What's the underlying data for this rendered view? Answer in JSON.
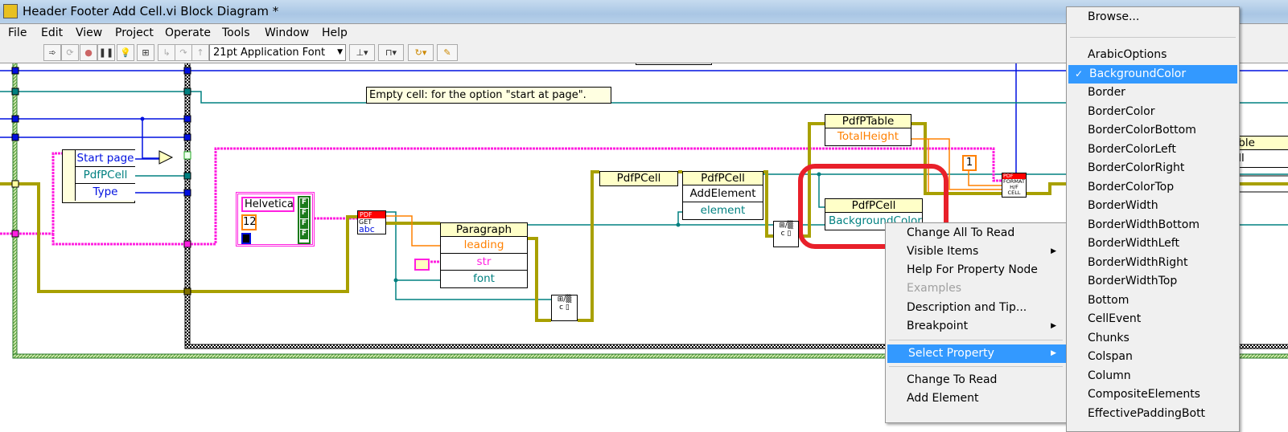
{
  "window": {
    "title": "Header Footer Add Cell.vi Block Diagram *"
  },
  "menu": [
    "File",
    "Edit",
    "View",
    "Project",
    "Operate",
    "Tools",
    "Window",
    "Help"
  ],
  "toolbar": {
    "font": "21pt Application Font",
    "buttons": [
      "run-arrow-icon",
      "run-continuous-icon",
      "abort-icon",
      "pause-icon",
      "highlight-execution-icon",
      "retain-wire-values-icon",
      "step-into-icon",
      "step-over-icon",
      "step-out-icon"
    ],
    "tools": [
      "align-icon",
      "distribute-icon",
      "reorder-icon",
      "cleanup-icon"
    ]
  },
  "diagram": {
    "note": "Empty cell:  for the option \"start at page\".",
    "bundle": {
      "rows": [
        "Start page",
        "PdfPCell",
        "Type"
      ]
    },
    "font_cluster": {
      "name": "Helvetica",
      "size": "12",
      "flags": [
        "F",
        "F",
        "F",
        "F"
      ]
    },
    "pdf_get": {
      "top": "PDF",
      "label": "GET",
      "abc": "abc"
    },
    "paragraph": {
      "title": "Paragraph",
      "rows": [
        "leading",
        "str",
        "font"
      ]
    },
    "pdfpcell_ctor": {
      "title": "PdfPCell"
    },
    "pdfpcell_add": {
      "title": "PdfPCell",
      "method": "AddElement",
      "param": "element"
    },
    "pdfptable": {
      "title": "PdfPTable",
      "prop": "TotalHeight"
    },
    "pdfpcell_prop": {
      "title": "PdfPCell",
      "prop": "BackgroundColor"
    },
    "const_one": "1",
    "format_cell": {
      "top": "PDF",
      "lines": [
        "FORMAT",
        "H/F",
        "CELL"
      ]
    },
    "partial_node": {
      "title": "able",
      "row": "ell"
    },
    "highlight_color": "#e8202a"
  },
  "context_menu": {
    "items": [
      {
        "label": "Change All To Read"
      },
      {
        "label": "Visible Items",
        "submenu": true
      },
      {
        "label": "Help For Property Node"
      },
      {
        "label": "Examples",
        "disabled": true
      },
      {
        "label": "Description and Tip..."
      },
      {
        "label": "Breakpoint",
        "submenu": true
      },
      {
        "label": "Select Property",
        "submenu": true,
        "highlighted": true
      },
      {
        "label": "Change To Read"
      },
      {
        "label": "Add Element"
      }
    ]
  },
  "property_submenu": {
    "browse": "Browse...",
    "checked": "BackgroundColor",
    "check_mark": "✓",
    "items": [
      "ArabicOptions",
      "BackgroundColor",
      "Border",
      "BorderColor",
      "BorderColorBottom",
      "BorderColorLeft",
      "BorderColorRight",
      "BorderColorTop",
      "BorderWidth",
      "BorderWidthBottom",
      "BorderWidthLeft",
      "BorderWidthRight",
      "BorderWidthTop",
      "Bottom",
      "CellEvent",
      "Chunks",
      "Colspan",
      "Column",
      "CompositeElements",
      "EffectivePaddingBott"
    ]
  }
}
